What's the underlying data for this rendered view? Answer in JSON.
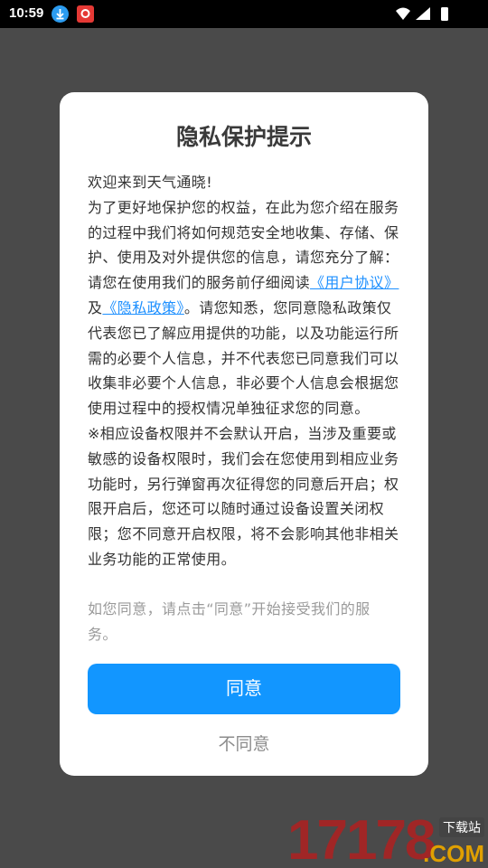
{
  "status_bar": {
    "time": "10:59",
    "icons": [
      "download-icon",
      "app-notification-icon",
      "wifi-icon",
      "signal-icon",
      "battery-icon"
    ]
  },
  "dialog": {
    "title": "隐私保护提示",
    "p1": "欢迎来到天气通晓!",
    "p2": "为了更好地保护您的权益，在此为您介绍在服务的过程中我们将如何规范安全地收集、存储、保护、使用及对外提供您的信息，请您充分了解：",
    "p3_pre": "请您在使用我们的服务前仔细阅读",
    "user_agreement_link": "《用户协议》",
    "p3_and": "及",
    "privacy_policy_link": "《隐私政策》",
    "p3_post": "。请您知悉，您同意隐私政策仅代表您已了解应用提供的功能，以及功能运行所需的必要个人信息，并不代表您已同意我们可以收集非必要个人信息，非必要个人信息会根据您使用过程中的授权情况单独征求您的同意。",
    "p4": "※相应设备权限并不会默认开启，当涉及重要或敏感的设备权限时，我们会在您使用到相应业务功能时，另行弹窗再次征得您的同意后开启；权限开启后，您还可以随时通过设备设置关闭权限；您不同意开启权限，将不会影响其他非相关业务功能的正常使用。",
    "agree_note": "如您同意，请点击“同意”开始接受我们的服务。",
    "agree_label": "同意",
    "disagree_label": "不同意"
  },
  "watermark": {
    "number": "17178",
    "tag": "下载站",
    "suffix": ".COM"
  },
  "colors": {
    "accent": "#1296ff",
    "link": "#1e90ff",
    "overlay": "#4a4a4a"
  }
}
